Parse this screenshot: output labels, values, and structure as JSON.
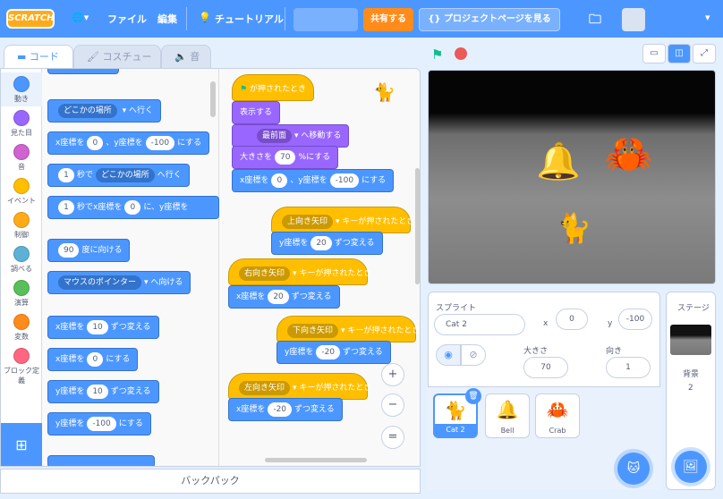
{
  "menubar": {
    "logo": "SCRATCH",
    "file": "ファイル",
    "edit": "編集",
    "tutorial": "チュートリアル",
    "share": "共有する",
    "project_page": "プロジェクトページを見る"
  },
  "tabs": {
    "code": "コード",
    "costume": "コスチューム",
    "sound": "音"
  },
  "categories": [
    "動き",
    "見た目",
    "音",
    "イベント",
    "制御",
    "調べる",
    "演算",
    "変数",
    "ブロック定義"
  ],
  "palette": {
    "goto": "どこかの場所",
    "goto_suffix": "へ行く",
    "setxy_x": "x座標を",
    "setxy_xval": "0",
    "setxy_y": "、y座標を",
    "setxy_yval": "-100",
    "setxy_end": "にする",
    "glide_sec": "1",
    "glide_word": "秒で",
    "glide_target": "どこかの場所",
    "glide_end": "へ行く",
    "glide2_sec": "1",
    "glide2_text": "秒でx座標を",
    "glide2_x": "0",
    "glide2_mid": "に、y座標を",
    "point_val": "90",
    "point_text": "度に向ける",
    "pointto": "マウスのポインター",
    "pointto_end": "へ向ける",
    "changex_a": "x座標を",
    "changex_v": "10",
    "changex_b": "ずつ変える",
    "setx_a": "x座標を",
    "setx_v": "0",
    "setx_b": "にする",
    "changey_a": "y座標を",
    "changey_v": "10",
    "changey_b": "ずつ変える",
    "sety_a": "y座標を",
    "sety_v": "-100",
    "sety_b": "にする"
  },
  "script": {
    "flag_hat": "が押されたとき",
    "show": "表示する",
    "front": "最前面",
    "front_end": "へ移動する",
    "size_a": "大きさを",
    "size_v": "70",
    "size_b": "%にする",
    "goto_a": "x座標を",
    "goto_x": "0",
    "goto_mid": "、y座標を",
    "goto_y": "-100",
    "goto_end": "にする",
    "up_key": "上向き矢印",
    "key_pressed": "キーが押されたとき",
    "up_a": "y座標を",
    "up_v": "20",
    "up_b": "ずつ変える",
    "right_key": "右向き矢印",
    "right_a": "x座標を",
    "right_v": "20",
    "right_b": "ずつ変える",
    "down_key": "下向き矢印",
    "down_a": "y座標を",
    "down_v": "-20",
    "down_b": "ずつ変える",
    "left_key": "左向き矢印",
    "left_a": "x座標を",
    "left_v": "-20",
    "left_b": "ずつ変える"
  },
  "backpack": "バックパック",
  "sprite_info": {
    "sprite_label": "スプライト",
    "name": "Cat 2",
    "x_label": "x",
    "x": "0",
    "y_label": "y",
    "y": "-100",
    "size_label": "大きさ",
    "size": "70",
    "direction_label": "向き",
    "direction": "1"
  },
  "sprites": [
    "Cat 2",
    "Bell",
    "Crab"
  ],
  "stage_panel": {
    "title": "ステージ",
    "backdrop_label": "背景",
    "backdrop_count": "2"
  }
}
